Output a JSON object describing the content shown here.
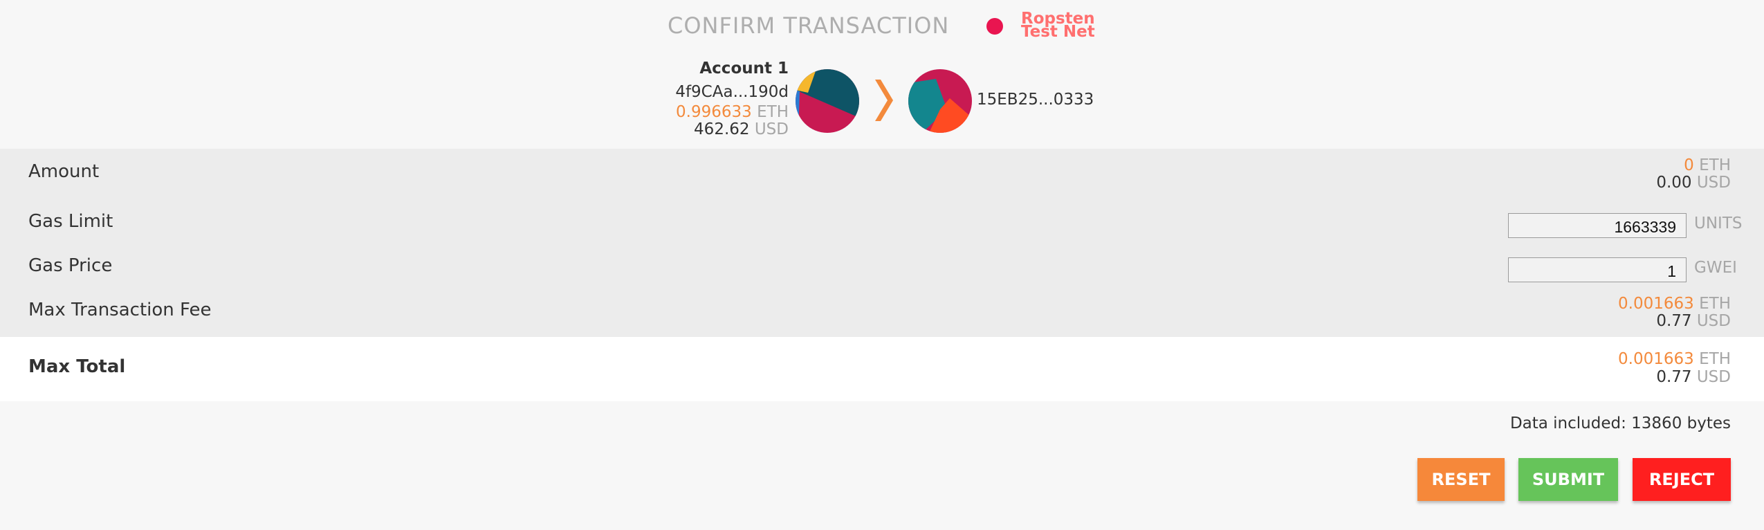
{
  "header": {
    "title": "CONFIRM TRANSACTION",
    "network_label": "Ropsten Test Net",
    "network_color": "#e91550"
  },
  "from_account": {
    "name": "Account 1",
    "address": "4f9CAa...190d",
    "eth_balance": "0.996633",
    "eth_unit": "ETH",
    "usd_balance": "462.62",
    "usd_unit": "USD",
    "avatar_icon": "identicon-avatar"
  },
  "arrow_icon": "chevron-right-icon",
  "to_account": {
    "address": "15EB25...0333",
    "avatar_icon": "identicon-avatar"
  },
  "details": {
    "amount": {
      "label": "Amount",
      "eth": "0",
      "eth_unit": "ETH",
      "usd": "0.00",
      "usd_unit": "USD"
    },
    "gas_limit": {
      "label": "Gas Limit",
      "value": "1663339",
      "unit": "UNITS"
    },
    "gas_price": {
      "label": "Gas Price",
      "value": "1",
      "unit": "GWEI"
    },
    "max_fee": {
      "label": "Max Transaction Fee",
      "eth": "0.001663",
      "eth_unit": "ETH",
      "usd": "0.77",
      "usd_unit": "USD"
    },
    "max_total": {
      "label": "Max Total",
      "eth": "0.001663",
      "eth_unit": "ETH",
      "usd": "0.77",
      "usd_unit": "USD"
    }
  },
  "data_included": "Data included: 13860 bytes",
  "buttons": {
    "reset": "RESET",
    "submit": "SUBMIT",
    "reject": "REJECT"
  },
  "colors": {
    "accent_orange": "#f38a3c",
    "reset": "#f6883a",
    "submit": "#66c45a",
    "reject": "#ff1f1f"
  }
}
